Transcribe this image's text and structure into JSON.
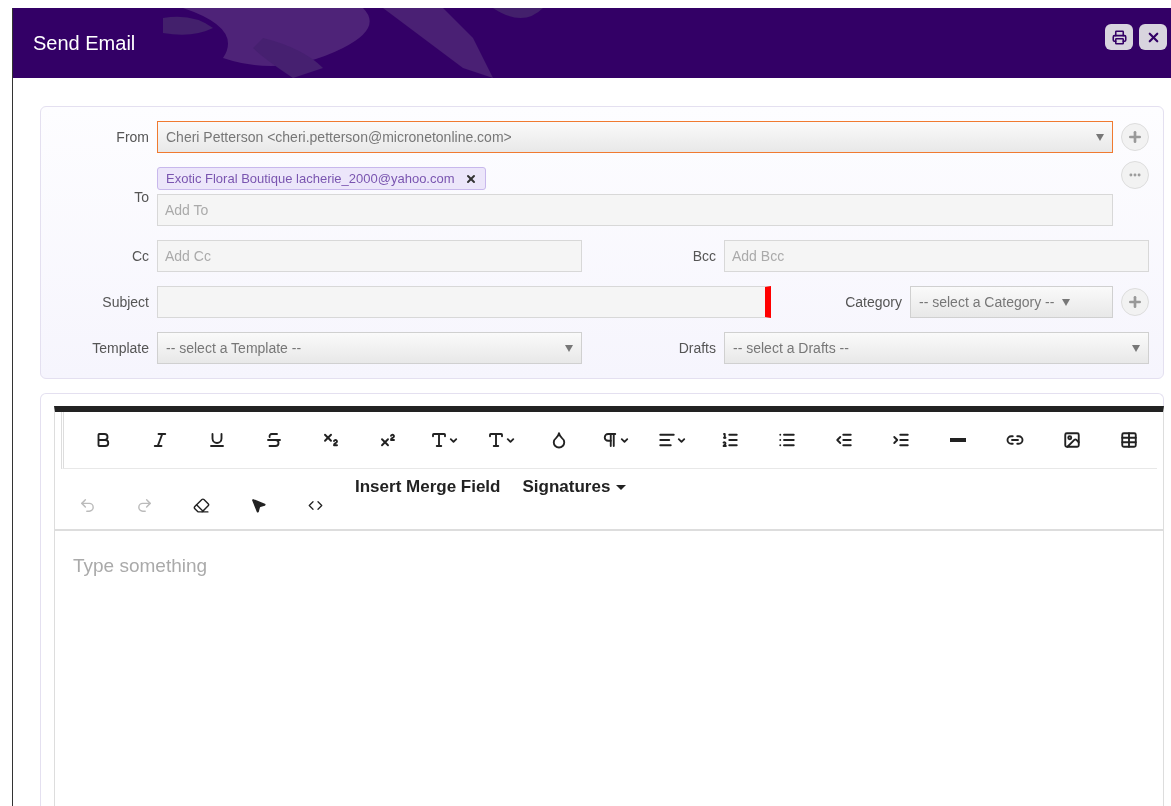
{
  "window": {
    "title": "Send Email"
  },
  "form": {
    "from": {
      "label": "From",
      "value": "Cheri Petterson <cheri.petterson@micronetonline.com>",
      "focused": true
    },
    "to": {
      "label": "To",
      "recipients": [
        {
          "text": "Exotic Floral Boutique lacherie_2000@yahoo.com"
        }
      ],
      "placeholder": "Add To"
    },
    "cc": {
      "label": "Cc",
      "placeholder": "Add Cc"
    },
    "bcc": {
      "label": "Bcc",
      "placeholder": "Add Bcc"
    },
    "subject": {
      "label": "Subject",
      "invalid": true
    },
    "category": {
      "label": "Category",
      "value": "-- select a Category --"
    },
    "template": {
      "label": "Template",
      "value": "-- select a Template --"
    },
    "drafts": {
      "label": "Drafts",
      "value": "-- select a Drafts --"
    }
  },
  "editor": {
    "history": [
      {
        "disabled": true
      },
      {
        "disabled": true
      }
    ],
    "menus": [
      {
        "label": "Insert Merge Field",
        "dropdown": false
      },
      {
        "label": "Signatures",
        "dropdown": true
      }
    ],
    "placeholder": "Type something"
  }
}
